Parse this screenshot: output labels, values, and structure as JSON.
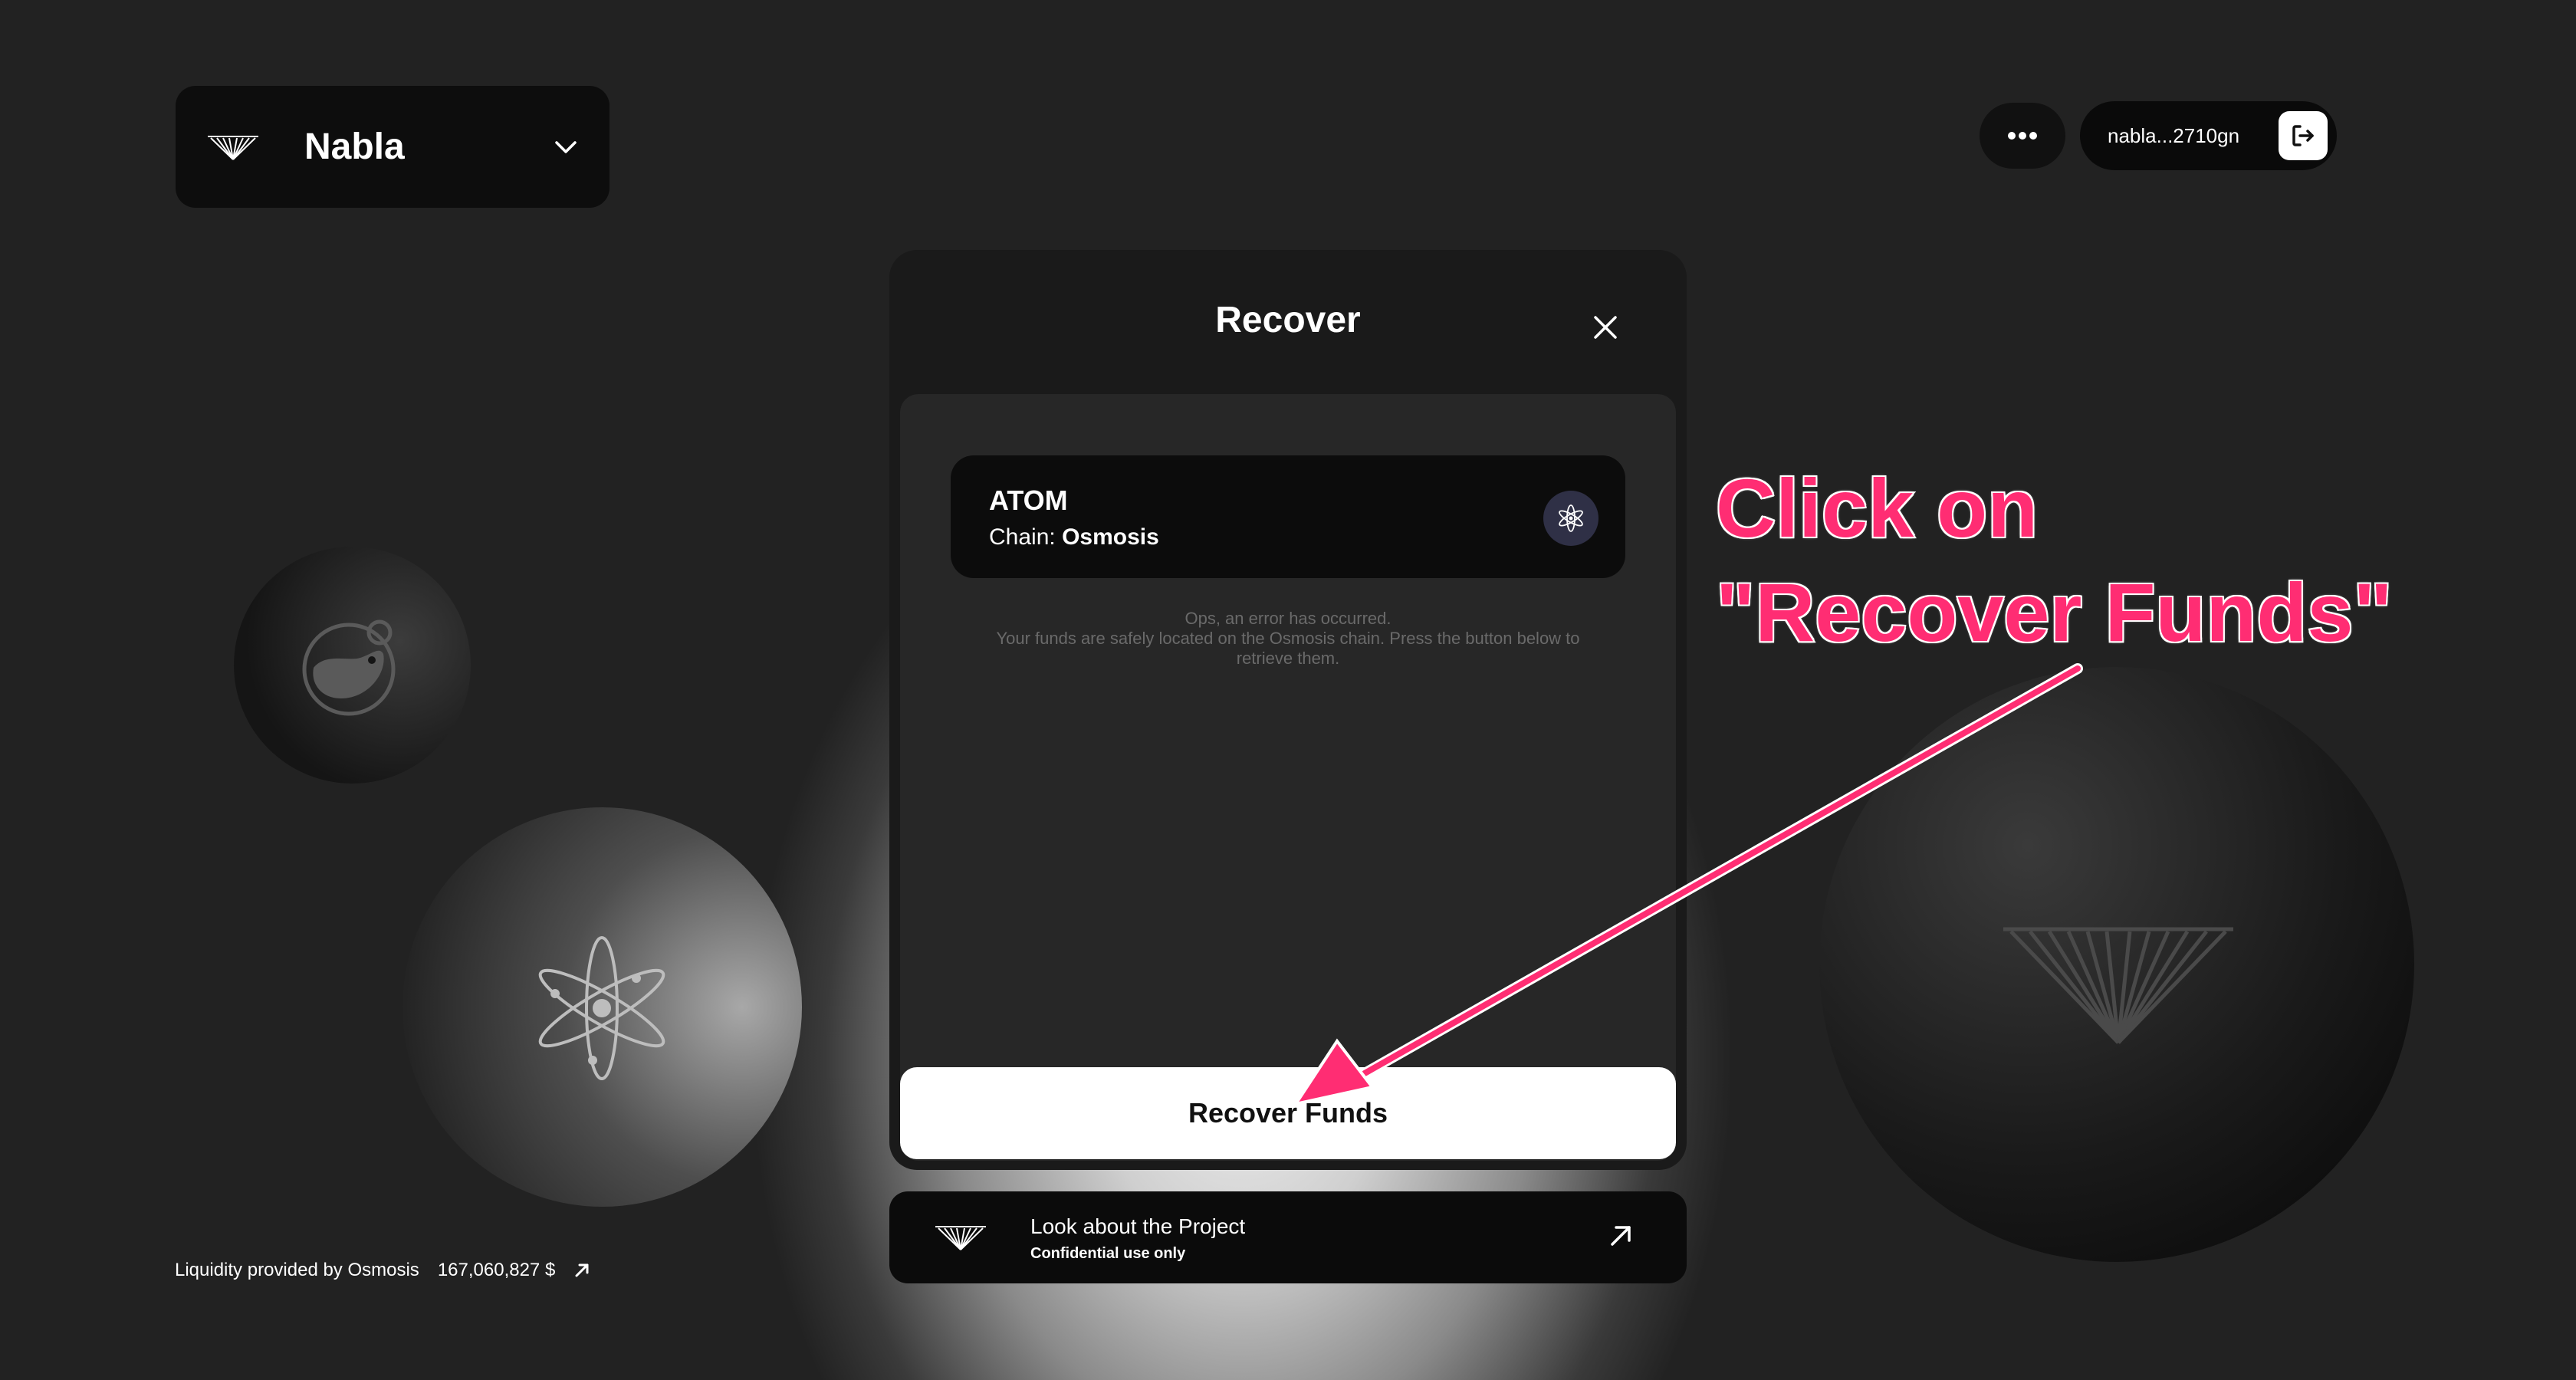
{
  "header": {
    "project_name": "Nabla",
    "wallet_address": "nabla...2710gn"
  },
  "modal": {
    "title": "Recover",
    "asset": {
      "symbol": "ATOM",
      "chain_label": "Chain:",
      "chain_name": "Osmosis"
    },
    "error_line1": "Ops, an error has occurred.",
    "error_line2": "Your funds are safely located on the Osmosis chain. Press the button below to retrieve them.",
    "recover_button": "Recover Funds"
  },
  "project_bar": {
    "title": "Look about the Project",
    "subtitle": "Confidential use only"
  },
  "footer": {
    "liquidity_label": "Liquidity provided by Osmosis",
    "liquidity_value": "167,060,827 $"
  },
  "annotation": {
    "line1": "Click on",
    "line2": "\"Recover Funds\"",
    "color": "#ff2d73"
  },
  "icons": {
    "logo": "nabla-logo-icon",
    "chevron": "chevron-down-icon",
    "more": "more-dots-icon",
    "logout": "logout-icon",
    "close": "close-icon",
    "atom": "cosmos-atom-icon",
    "osmosis": "osmosis-icon",
    "external": "arrow-up-right-icon"
  }
}
